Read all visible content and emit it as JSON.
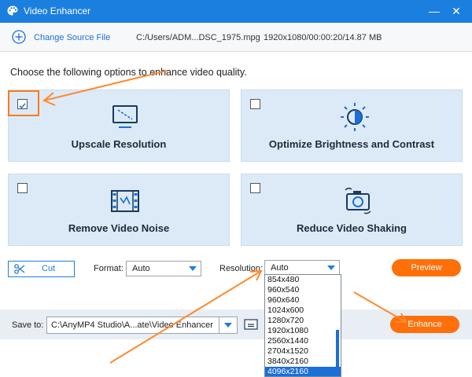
{
  "window": {
    "title": "Video Enhancer",
    "minimize": "—",
    "close": "✕"
  },
  "file": {
    "change_label": "Change Source File",
    "path": "C:/Users/ADM...DSC_1975.mpg",
    "info": "1920x1080/00:00:20/14.87 MB"
  },
  "instruction": "Choose the following options to enhance video quality.",
  "options": [
    {
      "label": "Upscale Resolution",
      "checked": true,
      "icon": "monitor-icon"
    },
    {
      "label": "Optimize Brightness and Contrast",
      "checked": false,
      "icon": "brightness-icon"
    },
    {
      "label": "Remove Video Noise",
      "checked": false,
      "icon": "film-icon"
    },
    {
      "label": "Reduce Video Shaking",
      "checked": false,
      "icon": "shaky-camera-icon"
    }
  ],
  "controls": {
    "cut_label": "Cut",
    "format_label": "Format:",
    "format_value": "Auto",
    "resolution_label": "Resolution:",
    "resolution_value": "Auto",
    "preview_label": "Preview",
    "enhance_label": "Enhance"
  },
  "resolution_options": [
    "854x480",
    "960x540",
    "960x640",
    "1024x600",
    "1280x720",
    "1920x1080",
    "2560x1440",
    "2704x1520",
    "3840x2160",
    "4096x2160"
  ],
  "resolution_selected": "4096x2160",
  "save": {
    "label": "Save to:",
    "path": "C:\\AnyMP4 Studio\\A...ate\\Video Enhancer"
  },
  "colors": {
    "accent": "#1b7fe0",
    "orange": "#ff6f0a",
    "card": "#dceaf8"
  }
}
